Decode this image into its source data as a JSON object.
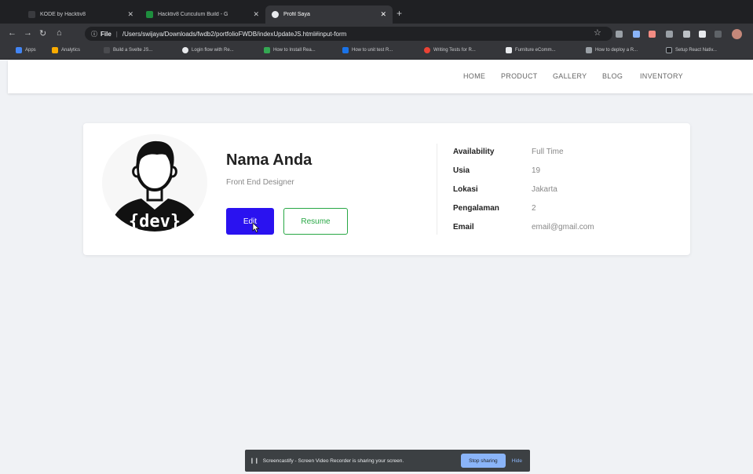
{
  "browser": {
    "tabs": [
      {
        "title": "KODE by Hacktiv8",
        "favicon_color": "#3a3b3f"
      },
      {
        "title": "Hacktiv8 Curiculum Build - G",
        "favicon_color": "#1e8e3e"
      },
      {
        "title": "Profil Saya",
        "favicon_color": "#e8eaed"
      }
    ],
    "address": {
      "file_label": "File",
      "url": "/Users/swijaya/Downloads/fwdb2/portfolioFWDB/indexUpdateJS.html#input-form"
    },
    "bookmarks": [
      {
        "label": "Apps"
      },
      {
        "label": "Analytics"
      },
      {
        "label": "Build a Svelte JS..."
      },
      {
        "label": "Login flow with Re..."
      },
      {
        "label": "How to Install Rea..."
      },
      {
        "label": "How to unit test R..."
      },
      {
        "label": "Writing Tests for R..."
      },
      {
        "label": "Furniture eComm..."
      },
      {
        "label": "How to deploy a R..."
      },
      {
        "label": "Setup React Nativ..."
      }
    ]
  },
  "nav": {
    "items": [
      "HOME",
      "PRODUCT",
      "GALLERY",
      "BLOG",
      "INVENTORY"
    ]
  },
  "profile": {
    "avatar_text": "{dev}",
    "name": "Nama Anda",
    "role": "Front End Designer",
    "edit_label": "Edit",
    "resume_label": "Resume",
    "info": [
      {
        "key": "Availability",
        "value": "Full Time"
      },
      {
        "key": "Usia",
        "value": "19"
      },
      {
        "key": "Lokasi",
        "value": "Jakarta"
      },
      {
        "key": "Pengalaman",
        "value": "2"
      },
      {
        "key": "Email",
        "value": "email@gmail.com"
      }
    ]
  },
  "screencast": {
    "message": "Screencastify - Screen Video Recorder is sharing your screen.",
    "stop_label": "Stop sharing",
    "hide_label": "Hide"
  },
  "colors": {
    "edit_button": "#2a12f0",
    "resume_border": "#28a745",
    "page_background": "#f0f2f5"
  }
}
